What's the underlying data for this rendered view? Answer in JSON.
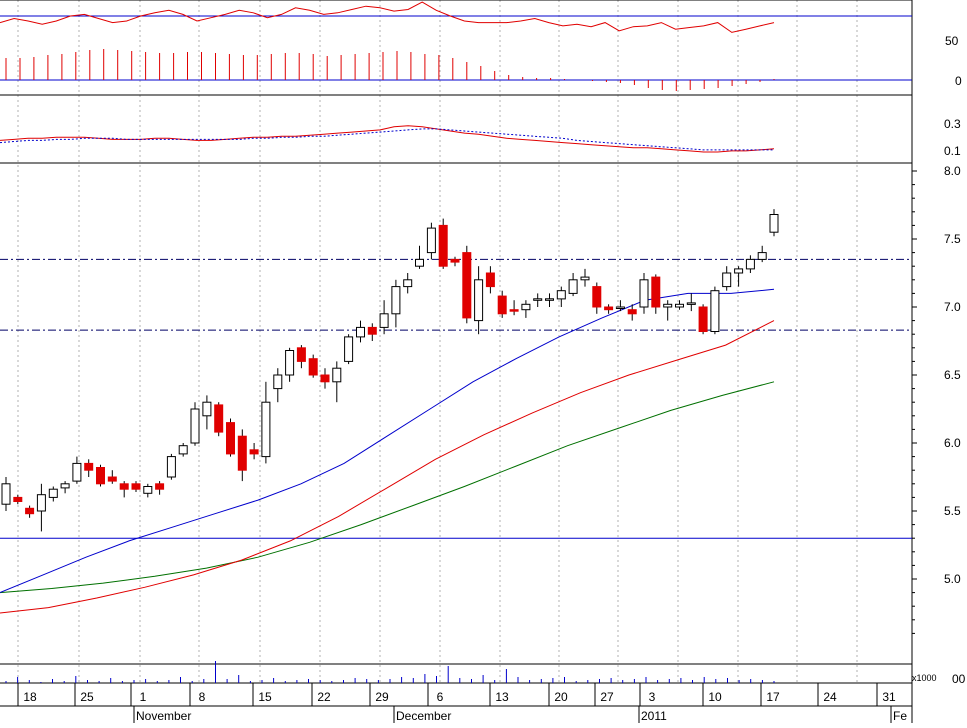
{
  "chart_data": {
    "type": "candlestick",
    "panels": {
      "oscillator": {
        "ticks": [
          "50",
          "0"
        ],
        "line": [
          70,
          75,
          72,
          68,
          72,
          78,
          80,
          75,
          70,
          72,
          78,
          82,
          85,
          80,
          72,
          76,
          80,
          85,
          82,
          76,
          80,
          88,
          85,
          80,
          82,
          86,
          90,
          88,
          84,
          86,
          95,
          85,
          78,
          72,
          70,
          70,
          70,
          72,
          75,
          70,
          66,
          68,
          65,
          70,
          60,
          65,
          66,
          70,
          62,
          64,
          66,
          70,
          58,
          62,
          66,
          70
        ],
        "histogram": [
          22,
          22,
          23,
          25,
          26,
          28,
          30,
          31,
          30,
          29,
          28,
          27,
          27,
          28,
          28,
          27,
          26,
          25,
          25,
          26,
          27,
          27,
          26,
          24,
          25,
          26,
          27,
          28,
          29,
          28,
          26,
          25,
          22,
          18,
          14,
          9,
          5,
          3,
          2,
          2,
          1,
          0,
          -1,
          -2,
          -3,
          -5,
          -8,
          -10,
          -11,
          -10,
          -9,
          -8,
          -6,
          -4,
          -2,
          1
        ]
      },
      "macd": {
        "ticks": [
          "0.3",
          "0.1"
        ],
        "macd": [
          0.21,
          0.22,
          0.23,
          0.23,
          0.24,
          0.24,
          0.24,
          0.23,
          0.22,
          0.22,
          0.22,
          0.23,
          0.23,
          0.22,
          0.21,
          0.21,
          0.22,
          0.23,
          0.24,
          0.24,
          0.25,
          0.25,
          0.26,
          0.27,
          0.28,
          0.29,
          0.3,
          0.31,
          0.34,
          0.35,
          0.34,
          0.32,
          0.3,
          0.28,
          0.27,
          0.25,
          0.23,
          0.22,
          0.21,
          0.2,
          0.19,
          0.18,
          0.17,
          0.16,
          0.15,
          0.14,
          0.14,
          0.13,
          0.12,
          0.11,
          0.1,
          0.1,
          0.11,
          0.11,
          0.12,
          0.13
        ],
        "signal": [
          0.19,
          0.2,
          0.21,
          0.21,
          0.22,
          0.22,
          0.23,
          0.23,
          0.23,
          0.22,
          0.22,
          0.22,
          0.22,
          0.22,
          0.22,
          0.22,
          0.22,
          0.22,
          0.23,
          0.23,
          0.24,
          0.24,
          0.25,
          0.25,
          0.26,
          0.27,
          0.28,
          0.29,
          0.3,
          0.31,
          0.32,
          0.32,
          0.31,
          0.3,
          0.29,
          0.28,
          0.27,
          0.26,
          0.25,
          0.24,
          0.23,
          0.21,
          0.2,
          0.19,
          0.18,
          0.17,
          0.16,
          0.15,
          0.14,
          0.13,
          0.12,
          0.12,
          0.12,
          0.12,
          0.12,
          0.12
        ]
      },
      "price": {
        "yticks": [
          8.0,
          7.5,
          7.0,
          6.5,
          6.0,
          5.5,
          5.0
        ],
        "ylim": [
          4.5,
          8.0
        ],
        "candles": [
          [
            5.55,
            5.75,
            5.5,
            5.7
          ],
          [
            5.6,
            5.62,
            5.55,
            5.57
          ],
          [
            5.52,
            5.54,
            5.45,
            5.48
          ],
          [
            5.5,
            5.7,
            5.35,
            5.62
          ],
          [
            5.6,
            5.68,
            5.57,
            5.66
          ],
          [
            5.67,
            5.72,
            5.63,
            5.7
          ],
          [
            5.72,
            5.9,
            5.7,
            5.85
          ],
          [
            5.85,
            5.88,
            5.75,
            5.8
          ],
          [
            5.82,
            5.84,
            5.68,
            5.7
          ],
          [
            5.75,
            5.8,
            5.7,
            5.72
          ],
          [
            5.7,
            5.72,
            5.6,
            5.66
          ],
          [
            5.7,
            5.72,
            5.64,
            5.66
          ],
          [
            5.63,
            5.7,
            5.6,
            5.68
          ],
          [
            5.7,
            5.72,
            5.62,
            5.66
          ],
          [
            5.75,
            5.92,
            5.73,
            5.9
          ],
          [
            5.92,
            6.0,
            5.9,
            5.98
          ],
          [
            6.0,
            6.3,
            5.98,
            6.25
          ],
          [
            6.2,
            6.35,
            6.1,
            6.3
          ],
          [
            6.28,
            6.3,
            6.05,
            6.08
          ],
          [
            6.15,
            6.18,
            5.9,
            5.92
          ],
          [
            6.05,
            6.1,
            5.72,
            5.8
          ],
          [
            5.95,
            6.0,
            5.88,
            5.92
          ],
          [
            5.9,
            6.45,
            5.85,
            6.3
          ],
          [
            6.4,
            6.55,
            6.3,
            6.5
          ],
          [
            6.5,
            6.7,
            6.45,
            6.68
          ],
          [
            6.7,
            6.72,
            6.55,
            6.6
          ],
          [
            6.62,
            6.65,
            6.48,
            6.5
          ],
          [
            6.5,
            6.55,
            6.4,
            6.45
          ],
          [
            6.45,
            6.6,
            6.3,
            6.55
          ],
          [
            6.6,
            6.8,
            6.58,
            6.78
          ],
          [
            6.78,
            6.9,
            6.74,
            6.85
          ],
          [
            6.85,
            6.88,
            6.75,
            6.8
          ],
          [
            6.85,
            7.05,
            6.8,
            6.95
          ],
          [
            6.95,
            7.2,
            6.85,
            7.15
          ],
          [
            7.15,
            7.25,
            7.1,
            7.2
          ],
          [
            7.3,
            7.45,
            7.28,
            7.35
          ],
          [
            7.4,
            7.62,
            7.35,
            7.58
          ],
          [
            7.6,
            7.65,
            7.28,
            7.3
          ],
          [
            7.35,
            7.37,
            7.3,
            7.33
          ],
          [
            7.4,
            7.45,
            6.88,
            6.92
          ],
          [
            6.9,
            7.3,
            6.8,
            7.2
          ],
          [
            7.25,
            7.3,
            7.1,
            7.15
          ],
          [
            7.08,
            7.12,
            6.92,
            6.95
          ],
          [
            6.98,
            7.05,
            6.94,
            6.97
          ],
          [
            6.98,
            7.05,
            6.92,
            7.02
          ],
          [
            7.05,
            7.1,
            7.0,
            7.06
          ],
          [
            7.06,
            7.1,
            7.0,
            7.06
          ],
          [
            7.06,
            7.15,
            7.0,
            7.12
          ],
          [
            7.1,
            7.25,
            7.08,
            7.2
          ],
          [
            7.2,
            7.28,
            7.15,
            7.22
          ],
          [
            7.15,
            7.18,
            6.95,
            7.0
          ],
          [
            7.0,
            7.02,
            6.95,
            6.98
          ],
          [
            7.0,
            7.05,
            6.97,
            7.0
          ],
          [
            6.98,
            7.02,
            6.9,
            6.95
          ],
          [
            7.0,
            7.25,
            6.95,
            7.2
          ],
          [
            7.22,
            7.24,
            6.95,
            7.0
          ],
          [
            7.0,
            7.05,
            6.9,
            7.02
          ],
          [
            7.0,
            7.05,
            6.98,
            7.02
          ],
          [
            7.02,
            7.1,
            6.97,
            7.03
          ],
          [
            7.0,
            7.02,
            6.8,
            6.82
          ],
          [
            6.82,
            7.15,
            6.8,
            7.12
          ],
          [
            7.15,
            7.3,
            7.12,
            7.25
          ],
          [
            7.25,
            7.3,
            7.15,
            7.28
          ],
          [
            7.28,
            7.38,
            7.25,
            7.35
          ],
          [
            7.35,
            7.45,
            7.33,
            7.4
          ],
          [
            7.55,
            7.72,
            7.52,
            7.68
          ]
        ],
        "candles_note": "each candle is [open, high, low, close]",
        "ma_short": [
          4.9,
          5.03,
          5.16,
          5.28,
          5.38,
          5.48,
          5.58,
          5.7,
          5.85,
          6.05,
          6.25,
          6.45,
          6.62,
          6.78,
          6.92,
          7.05,
          7.1,
          7.1,
          7.13
        ],
        "ma_mid": [
          4.75,
          4.79,
          4.86,
          4.94,
          5.03,
          5.14,
          5.28,
          5.46,
          5.67,
          5.88,
          6.06,
          6.22,
          6.37,
          6.5,
          6.61,
          6.72,
          6.9
        ],
        "ma_long": [
          4.9,
          4.93,
          4.97,
          5.02,
          5.08,
          5.16,
          5.27,
          5.4,
          5.54,
          5.68,
          5.83,
          5.98,
          6.11,
          6.24,
          6.35,
          6.45
        ],
        "horizontal_lines": [
          7.35,
          6.83,
          5.3
        ]
      },
      "volume": {
        "unit_label": "x1000",
        "tick_label": "00",
        "bars": [
          2,
          6,
          3,
          1,
          4,
          2,
          7,
          3,
          2,
          5,
          2,
          3,
          4,
          2,
          3,
          6,
          2,
          4,
          22,
          4,
          8,
          2,
          3,
          5,
          2,
          3,
          4,
          3,
          2,
          3,
          5,
          4,
          3,
          4,
          6,
          5,
          9,
          7,
          17,
          5,
          4,
          8,
          3,
          14,
          6,
          3,
          4,
          5,
          6,
          2,
          3,
          4,
          5,
          3,
          4,
          6,
          3,
          4,
          5,
          3,
          6,
          4,
          5,
          3,
          4,
          3,
          2
        ]
      }
    },
    "x_axis": {
      "day_labels": [
        "18",
        "25",
        "1",
        "8",
        "15",
        "22",
        "29",
        "6",
        "13",
        "20",
        "27",
        "3",
        "10",
        "17",
        "24",
        "31"
      ],
      "month_labels": [
        "November",
        "December",
        "2011",
        "Fe"
      ]
    }
  }
}
